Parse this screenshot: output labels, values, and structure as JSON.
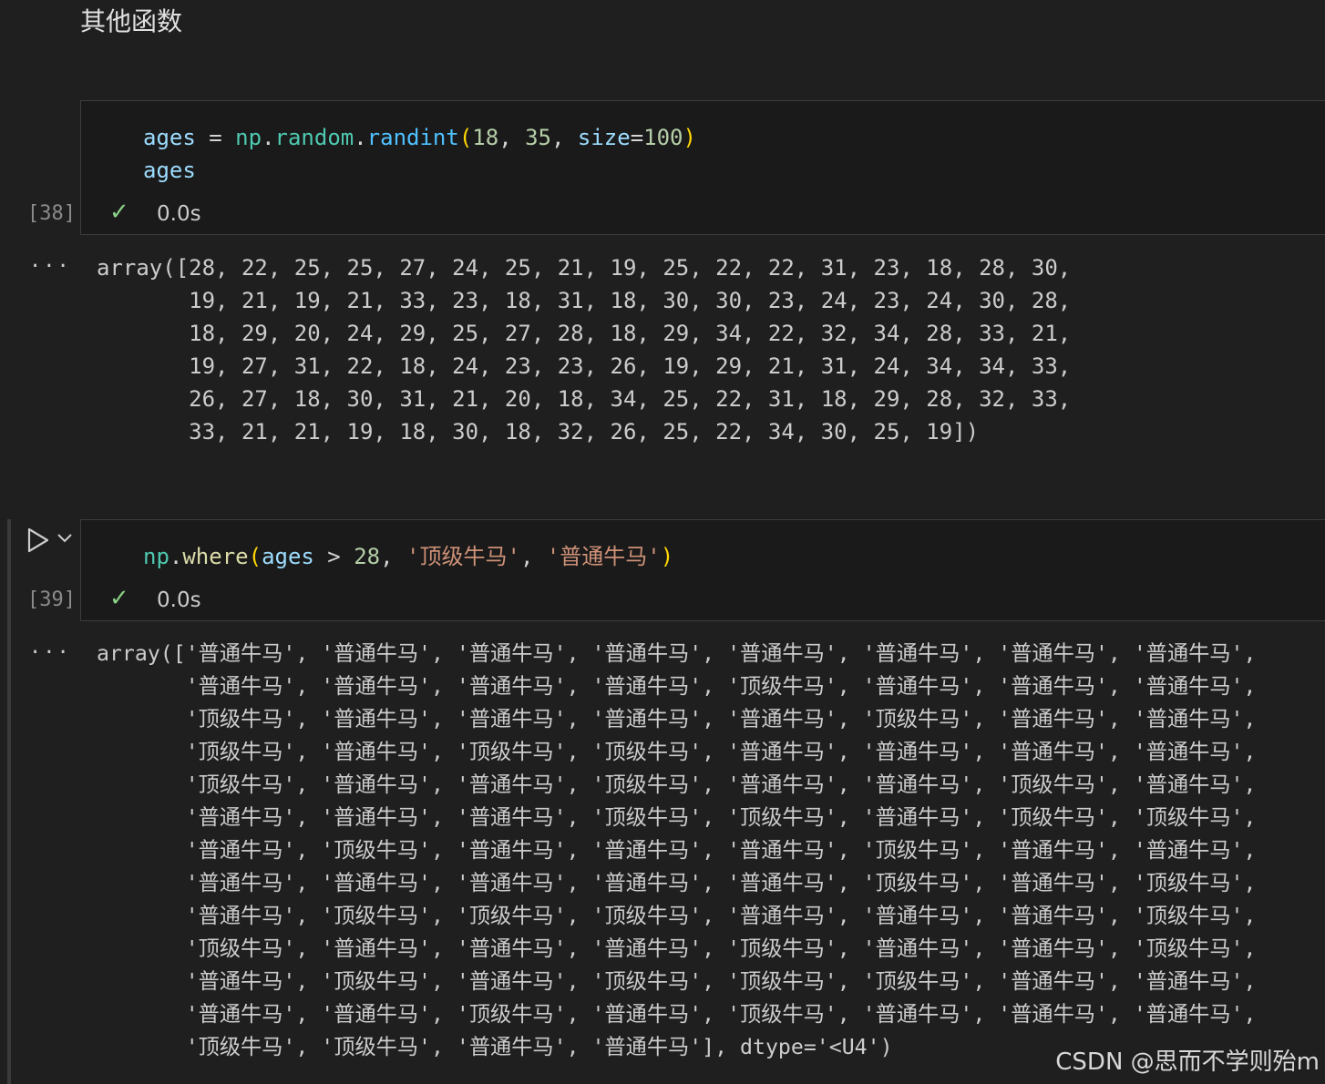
{
  "markdown": {
    "heading": "其他函数"
  },
  "cell38": {
    "exec_count": "[38]",
    "duration": "0.0s",
    "code": {
      "l1": {
        "var": "ages",
        "eq": " = ",
        "mod": "np",
        "dot1": ".",
        "attr": "random",
        "dot2": ".",
        "fn": "randint",
        "lp": "(",
        "a1": "18",
        "c1": ", ",
        "a2": "35",
        "c2": ", ",
        "kw": "size",
        "eq2": "=",
        "a3": "100",
        "rp": ")"
      },
      "l2": "ages"
    },
    "output_marker": "···",
    "output": "array([28, 22, 25, 25, 27, 24, 25, 21, 19, 25, 22, 22, 31, 23, 18, 28, 30,\n       19, 21, 19, 21, 33, 23, 18, 31, 18, 30, 30, 23, 24, 23, 24, 30, 28,\n       18, 29, 20, 24, 29, 25, 27, 28, 18, 29, 34, 22, 32, 34, 28, 33, 21,\n       19, 27, 31, 22, 18, 24, 23, 23, 26, 19, 29, 21, 31, 24, 34, 34, 33,\n       26, 27, 18, 30, 31, 21, 20, 18, 34, 25, 22, 31, 18, 29, 28, 32, 33,\n       33, 21, 21, 19, 18, 30, 18, 32, 26, 25, 22, 34, 30, 25, 19])"
  },
  "cell39": {
    "exec_count": "[39]",
    "duration": "0.0s",
    "code": {
      "mod": "np",
      "dot": ".",
      "fn": "where",
      "lp": "(",
      "var": "ages",
      "op": " > ",
      "num": "28",
      "c1": ", ",
      "s1": "'顶级牛马'",
      "c2": ", ",
      "s2": "'普通牛马'",
      "rp": ")"
    },
    "output_marker": "···",
    "output": "array(['普通牛马', '普通牛马', '普通牛马', '普通牛马', '普通牛马', '普通牛马', '普通牛马', '普通牛马',\n       '普通牛马', '普通牛马', '普通牛马', '普通牛马', '顶级牛马', '普通牛马', '普通牛马', '普通牛马',\n       '顶级牛马', '普通牛马', '普通牛马', '普通牛马', '普通牛马', '顶级牛马', '普通牛马', '普通牛马',\n       '顶级牛马', '普通牛马', '顶级牛马', '顶级牛马', '普通牛马', '普通牛马', '普通牛马', '普通牛马',\n       '顶级牛马', '普通牛马', '普通牛马', '顶级牛马', '普通牛马', '普通牛马', '顶级牛马', '普通牛马',\n       '普通牛马', '普通牛马', '普通牛马', '顶级牛马', '顶级牛马', '普通牛马', '顶级牛马', '顶级牛马',\n       '普通牛马', '顶级牛马', '普通牛马', '普通牛马', '普通牛马', '顶级牛马', '普通牛马', '普通牛马',\n       '普通牛马', '普通牛马', '普通牛马', '普通牛马', '普通牛马', '顶级牛马', '普通牛马', '顶级牛马',\n       '普通牛马', '顶级牛马', '顶级牛马', '顶级牛马', '普通牛马', '普通牛马', '普通牛马', '顶级牛马',\n       '顶级牛马', '普通牛马', '普通牛马', '普通牛马', '顶级牛马', '普通牛马', '普通牛马', '顶级牛马',\n       '普通牛马', '顶级牛马', '普通牛马', '顶级牛马', '顶级牛马', '顶级牛马', '普通牛马', '普通牛马',\n       '普通牛马', '普通牛马', '顶级牛马', '普通牛马', '顶级牛马', '普通牛马', '普通牛马', '普通牛马',\n       '顶级牛马', '顶级牛马', '普通牛马', '普通牛马'], dtype='<U4')"
  },
  "watermark": "CSDN @思而不学则殆m",
  "colors": {
    "background": "#1f1f1f",
    "success": "#89d185",
    "variable": "#9cdcfe",
    "function": "#dcdcaa",
    "module": "#4ec9b0",
    "number": "#b5cea8",
    "string": "#ce9178"
  },
  "icons": {
    "run": "play-icon",
    "run_options": "chevron-down-icon",
    "status": "check-icon"
  }
}
